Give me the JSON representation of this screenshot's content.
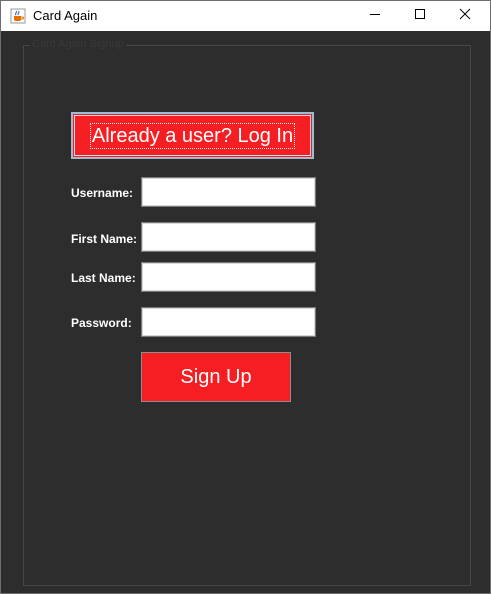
{
  "window": {
    "title": "Card Again",
    "icon": "java-cup-icon"
  },
  "panel": {
    "group_title": "Card Again Signup"
  },
  "form": {
    "login_button": "Already a user? Log In",
    "username_label": "Username:",
    "username_value": "",
    "firstname_label": "First Name:",
    "firstname_value": "",
    "lastname_label": "Last Name:",
    "lastname_value": "",
    "password_label": "Password:",
    "password_value": "",
    "signup_button": "Sign Up"
  },
  "colors": {
    "background": "#2d2d2d",
    "accent_red": "#f51f23",
    "text": "#ffffff"
  }
}
